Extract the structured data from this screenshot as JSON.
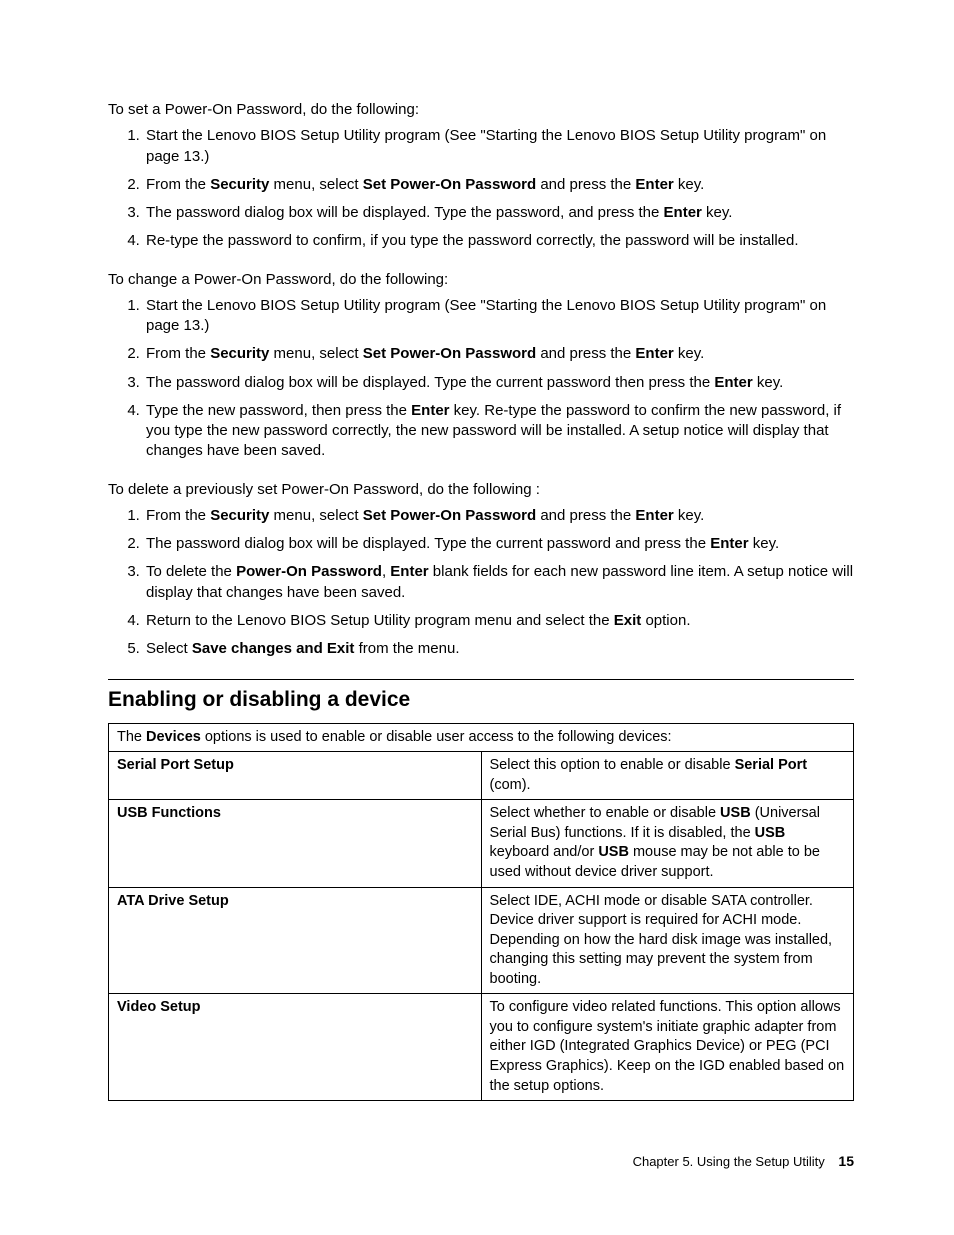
{
  "section1": {
    "intro": "To set a Power-On Password, do the following:",
    "items": [
      {
        "pre": "Start the Lenovo BIOS Setup Utility program (See \"Starting the Lenovo BIOS Setup Utility program\" on page 13.)"
      },
      {
        "t1": "From the ",
        "b1": "Security",
        "t2": " menu, select ",
        "b2": "Set Power-On Password",
        "t3": " and press the ",
        "b3": "Enter",
        "t4": " key."
      },
      {
        "t1": "The password dialog box will be displayed. Type the password, and press the ",
        "b1": "Enter",
        "t2": " key."
      },
      {
        "t1": "Re-type the password to confirm, if you type the password correctly, the password will be installed."
      }
    ]
  },
  "section2": {
    "intro": "To change a Power-On Password, do the following:",
    "items": [
      {
        "pre": "Start the Lenovo BIOS Setup Utility program (See \"Starting the Lenovo BIOS Setup Utility program\" on page 13.)"
      },
      {
        "t1": "From the ",
        "b1": "Security",
        "t2": " menu, select ",
        "b2": "Set Power-On Password",
        "t3": " and press the ",
        "b3": "Enter",
        "t4": " key."
      },
      {
        "t1": "The password dialog box will be displayed. Type the current password then press the ",
        "b1": "Enter",
        "t2": " key."
      },
      {
        "t1": "Type the new password, then press the ",
        "b1": "Enter",
        "t2": " key. Re-type the password to confirm the new password, if you type the new password correctly, the new password will be installed. A setup notice will display that changes have been saved."
      }
    ]
  },
  "section3": {
    "intro": "To delete a previously set Power-On Password, do the following :",
    "items": [
      {
        "t1": "From the ",
        "b1": "Security",
        "t2": " menu, select ",
        "b2": "Set Power-On Password",
        "t3": " and press the ",
        "b3": "Enter",
        "t4": " key."
      },
      {
        "t1": "The password dialog box will be displayed. Type the current password and press the ",
        "b1": "Enter",
        "t2": " key."
      },
      {
        "t1": "To delete the ",
        "b1": "Power-On Password",
        "t2": ", ",
        "b2": "Enter",
        "t3": " blank fields for each new password line item. A setup notice will display that changes have been saved."
      },
      {
        "t1": "Return to the Lenovo BIOS Setup Utility program menu and select the ",
        "b1": "Exit",
        "t2": " option."
      },
      {
        "t1": "Select ",
        "b1": "Save changes and Exit",
        "t2": " from the menu."
      }
    ]
  },
  "heading": "Enabling or disabling a device",
  "table": {
    "intro_pre": "The ",
    "intro_bold": "Devices",
    "intro_post": " options is used to enable or disable user access to the following devices:",
    "rows": [
      {
        "left": "Serial Port Setup",
        "right_pre": "Select this option to enable or disable ",
        "right_b1": "Serial Port",
        "right_post": " (com)."
      },
      {
        "left": "USB Functions",
        "right_pre": "Select whether to enable or disable ",
        "right_b1": "USB",
        "right_mid1": " (Universal Serial Bus) functions. If it is disabled, the ",
        "right_b2": "USB",
        "right_mid2": " keyboard and/or ",
        "right_b3": "USB",
        "right_post": " mouse may be not able to be used without device driver support."
      },
      {
        "left": "ATA Drive Setup",
        "right_plain": "Select IDE, ACHI mode or disable SATA controller. Device driver support is required for ACHI mode. Depending on how the hard disk image was installed, changing this setting may prevent the system from booting."
      },
      {
        "left": "Video Setup",
        "right_plain": "To configure video related functions. This option allows you to configure system's initiate graphic adapter from either IGD (Integrated Graphics Device) or PEG (PCI Express Graphics). Keep on the IGD enabled based on the setup options."
      }
    ]
  },
  "footer": {
    "chapter": "Chapter 5. Using the Setup Utility",
    "page": "15"
  }
}
